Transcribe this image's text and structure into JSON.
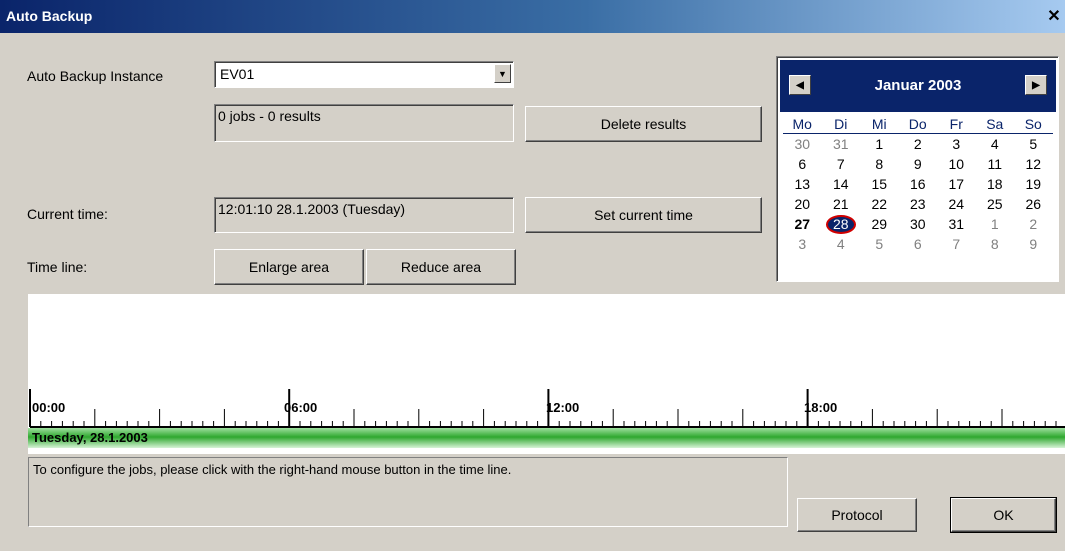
{
  "window": {
    "title": "Auto Backup",
    "close_glyph": "✕"
  },
  "instance": {
    "label": "Auto Backup Instance",
    "value": "EV01",
    "summary": "0 jobs - 0 results"
  },
  "buttons": {
    "delete_results": "Delete results",
    "set_current_time": "Set current time",
    "enlarge_area": "Enlarge area",
    "reduce_area": "Reduce area",
    "protocol": "Protocol",
    "ok": "OK"
  },
  "current_time": {
    "label": "Current time:",
    "value": "12:01:10 28.1.2003 (Tuesday)"
  },
  "timeline": {
    "label": "Time line:",
    "hour_labels": [
      "00:00",
      "06:00",
      "12:00",
      "18:00"
    ],
    "day_label": "Tuesday, 28.1.2003"
  },
  "message": "To configure the jobs, please click with the right-hand mouse button in the time line.",
  "calendar": {
    "month": "Januar 2003",
    "weekdays": [
      "Mo",
      "Di",
      "Mi",
      "Do",
      "Fr",
      "Sa",
      "So"
    ],
    "weeks": [
      [
        {
          "d": "30",
          "m": true
        },
        {
          "d": "31",
          "m": true
        },
        {
          "d": "1"
        },
        {
          "d": "2"
        },
        {
          "d": "3"
        },
        {
          "d": "4"
        },
        {
          "d": "5"
        }
      ],
      [
        {
          "d": "6"
        },
        {
          "d": "7"
        },
        {
          "d": "8"
        },
        {
          "d": "9"
        },
        {
          "d": "10"
        },
        {
          "d": "11"
        },
        {
          "d": "12"
        }
      ],
      [
        {
          "d": "13"
        },
        {
          "d": "14"
        },
        {
          "d": "15"
        },
        {
          "d": "16"
        },
        {
          "d": "17"
        },
        {
          "d": "18"
        },
        {
          "d": "19"
        }
      ],
      [
        {
          "d": "20"
        },
        {
          "d": "21"
        },
        {
          "d": "22"
        },
        {
          "d": "23"
        },
        {
          "d": "24"
        },
        {
          "d": "25"
        },
        {
          "d": "26"
        }
      ],
      [
        {
          "d": "27",
          "t": true
        },
        {
          "d": "28",
          "s": true
        },
        {
          "d": "29"
        },
        {
          "d": "30"
        },
        {
          "d": "31"
        },
        {
          "d": "1",
          "m": true
        },
        {
          "d": "2",
          "m": true
        }
      ],
      [
        {
          "d": "3",
          "m": true
        },
        {
          "d": "4",
          "m": true
        },
        {
          "d": "5",
          "m": true
        },
        {
          "d": "6",
          "m": true
        },
        {
          "d": "7",
          "m": true
        },
        {
          "d": "8",
          "m": true
        },
        {
          "d": "9",
          "m": true
        }
      ]
    ]
  },
  "colors": {
    "title_bar": "#0a246a",
    "selection_ring": "#d00000",
    "day_band": "#2fa82f"
  }
}
